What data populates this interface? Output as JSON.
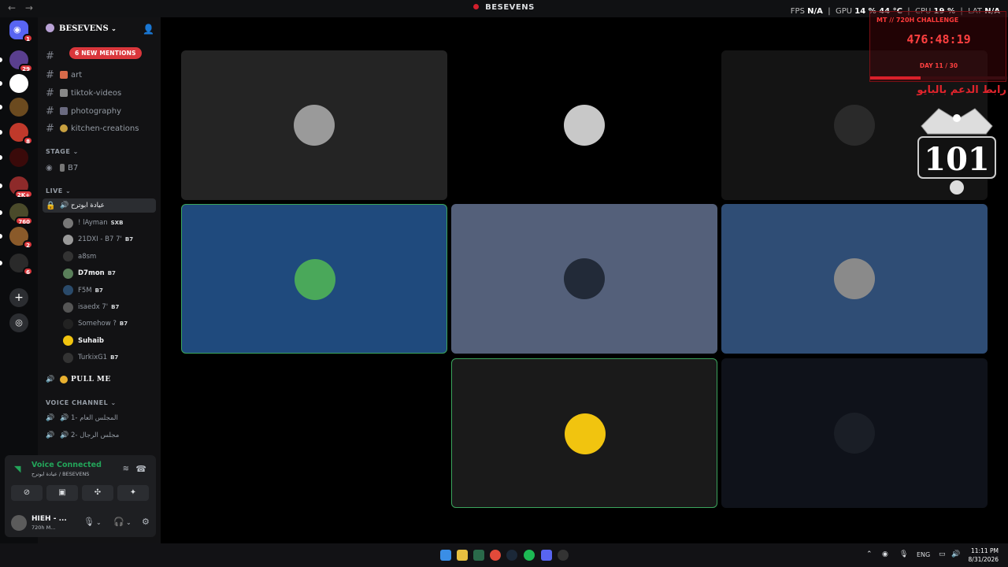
{
  "titlebar": {
    "title": "BESEVENS",
    "nav": "← →"
  },
  "perf_overlay": {
    "fps_label": "FPS",
    "fps": "N/A",
    "gpu_label": "GPU",
    "gpu": "14 % 44 °C",
    "cpu_label": "CPU",
    "cpu": "19 %",
    "lat_label": "LAT",
    "lat": "N/A"
  },
  "challenge": {
    "label": "MT // 720H CHALLENGE",
    "timer": "476:48:19",
    "day": "DAY 11 / 30",
    "progress_fraction": 0.37,
    "color": "#ff4040"
  },
  "stream_overlay": {
    "arabic_text": "رابط الدعم بالبايو",
    "logo_text": "101"
  },
  "guilds": {
    "home_badge": "1",
    "items": [
      {
        "badge": "29",
        "color": "#5a3f8f"
      },
      {
        "badge": "",
        "color": "#ffffff"
      },
      {
        "badge": "",
        "color": "#6b4a1f"
      },
      {
        "badge": "8",
        "color": "#c0392b"
      },
      {
        "badge": "",
        "color": "#3a0a0a"
      },
      {
        "badge": "2K+",
        "color": "#8e2a2a"
      },
      {
        "badge": "760",
        "color": "#4a4a2a"
      },
      {
        "badge": "2",
        "color": "#8a5a2a"
      },
      {
        "badge": "6",
        "color": "#2a2a2a"
      }
    ]
  },
  "sidebar": {
    "server_name": "BESEVENS",
    "mentions": "6 NEW MENTIONS",
    "channels": [
      {
        "name": "art",
        "bright": true
      },
      {
        "name": "tiktok-videos",
        "bright": false
      },
      {
        "name": "photography",
        "bright": true
      },
      {
        "name": "kitchen-creations",
        "bright": false
      }
    ],
    "stage_header": "STAGE",
    "stage_channel": "B7",
    "live_header": "LIVE",
    "live_channel": "عيادة ابوترح",
    "members": [
      {
        "name": "! lAyman",
        "tag": "SXB",
        "bold": false,
        "color": "#777"
      },
      {
        "name": "21DXI - B7 7'",
        "tag": "B7",
        "bold": false,
        "color": "#999"
      },
      {
        "name": "a8sm",
        "tag": "",
        "bold": false,
        "color": "#333"
      },
      {
        "name": "D7mon",
        "tag": "B7",
        "bold": true,
        "color": "#5a7f5a"
      },
      {
        "name": "F5M",
        "tag": "B7",
        "bold": false,
        "color": "#2a4a6a"
      },
      {
        "name": "isaedx 7'",
        "tag": "B7",
        "bold": false,
        "color": "#555"
      },
      {
        "name": "Somehow ?",
        "tag": "B7",
        "bold": false,
        "color": "#222"
      },
      {
        "name": "Suhaib",
        "tag": "",
        "bold": true,
        "color": "#f1c40f"
      },
      {
        "name": "TurkixG1",
        "tag": "B7",
        "bold": false,
        "color": "#333"
      }
    ],
    "pull_channel": "PULL ME",
    "voice_header": "VOICE CHANNEL",
    "voice_channels": [
      "المجلس العام -1",
      "مجلس الرجال -2"
    ]
  },
  "voice_panel": {
    "status": "Voice Connected",
    "location": "عيادة ابوترح / BESEVENS",
    "username": "HIEH - ...",
    "user_status": "720h M..."
  },
  "tiles": [
    {
      "bg": "#242424",
      "avatar": "#9a9a9a",
      "speaking": false
    },
    {
      "bg": "#000000",
      "avatar": "#c8c8c8",
      "speaking": false
    },
    {
      "bg": "#141414",
      "avatar": "#2a2a2a",
      "speaking": false
    },
    {
      "bg": "#1f4a7d",
      "avatar": "#4aa85a",
      "speaking": true
    },
    {
      "bg": "#54607a",
      "avatar": "#222a38",
      "speaking": false
    },
    {
      "bg": "#2f4d75",
      "avatar": "#8a8a8a",
      "speaking": false
    },
    {
      "bg": "#000000",
      "avatar": "#000000",
      "speaking": false
    },
    {
      "bg": "#1a1a1a",
      "avatar": "#f1c40f",
      "speaking": true
    },
    {
      "bg": "#0f121a",
      "avatar": "#1a1e26",
      "speaking": false
    }
  ],
  "taskbar": {
    "lang": "ENG",
    "time": "11:11 PM",
    "date": "8/31/2026"
  }
}
